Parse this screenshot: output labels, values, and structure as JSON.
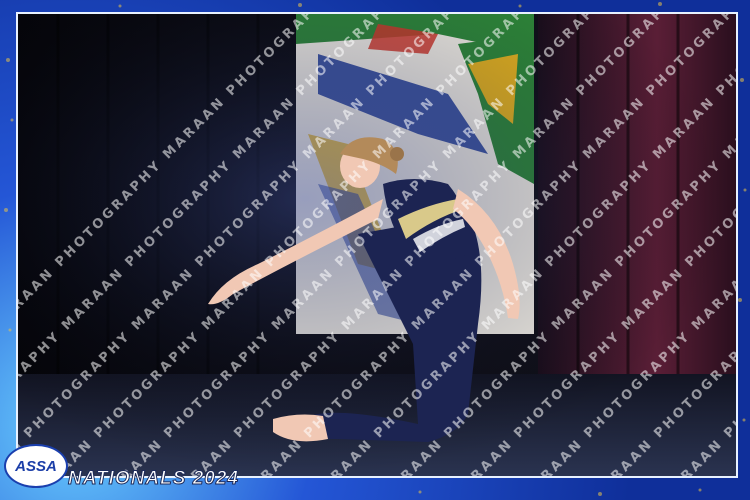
{
  "caption": "NATIONALS 2024",
  "logo_text": "ASSA",
  "watermark_text": "MARAAN PHOTOGRAPHY",
  "colors": {
    "frame": "#1a3fae",
    "frame_light": "#6ad0ff",
    "curtain": "#0b0b12",
    "costume": "#1c2452",
    "costume_accent": "#d9c98a",
    "skin": "#f1c8b4",
    "hair": "#b38a5a",
    "banner_green": "#2f8a3a",
    "banner_gold": "#e8b520",
    "banner_blue": "#1f3b9a",
    "banner_red": "#d63a2b"
  }
}
